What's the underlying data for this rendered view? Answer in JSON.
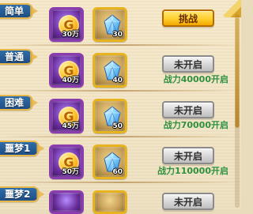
{
  "rows": [
    {
      "tag": "简单",
      "coin_qty": "30万",
      "crystal_qty": "30",
      "button_label": "挑战",
      "requirement": ""
    },
    {
      "tag": "普通",
      "coin_qty": "40万",
      "crystal_qty": "40",
      "button_label": "未开启",
      "requirement": "战力40000开启"
    },
    {
      "tag": "困难",
      "coin_qty": "45万",
      "crystal_qty": "50",
      "button_label": "未开启",
      "requirement": "战力70000开启"
    },
    {
      "tag": "噩梦1",
      "coin_qty": "50万",
      "crystal_qty": "60",
      "button_label": "未开启",
      "requirement": "战力110000开启"
    },
    {
      "tag": "噩梦2",
      "coin_qty": "",
      "crystal_qty": "",
      "button_label": "未开启",
      "requirement": ""
    }
  ],
  "icons": {
    "coin_glyph": "G",
    "coin_icon": "gold-coin-icon",
    "crystal_icon": "blue-crystal-icon"
  },
  "colors": {
    "tag_bg": "#2f6da7",
    "tag_border": "#e7b64a",
    "challenge_button": "#ffcf2e",
    "locked_button": "#d6d6d6",
    "requirement_text": "#2f8f3b",
    "coin_frame": "#8b3db0",
    "crystal_frame": "#e7b31f"
  }
}
